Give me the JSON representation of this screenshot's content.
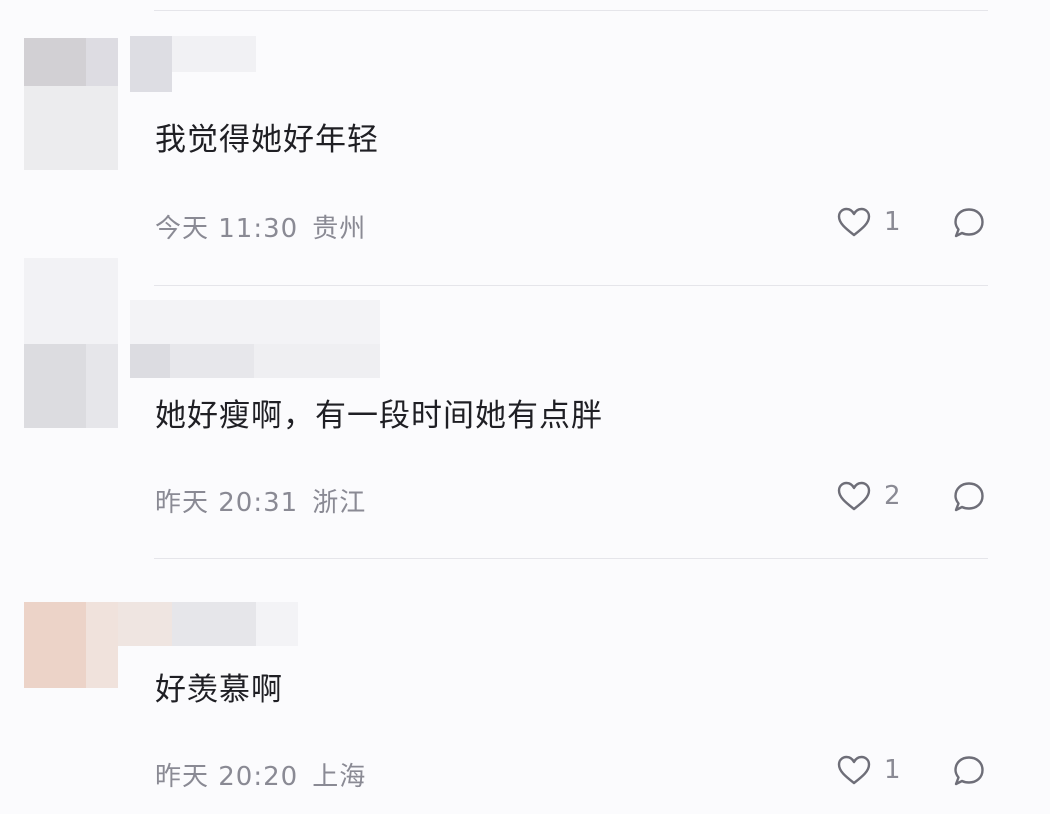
{
  "comments": [
    {
      "text": "我觉得她好年轻",
      "time": "今天 11:30",
      "location": "贵州",
      "likes": "1"
    },
    {
      "text": "她好瘦啊，有一段时间她有点胖",
      "time": "昨天 20:31",
      "location": "浙江",
      "likes": "2"
    },
    {
      "text": "好羡慕啊",
      "time": "昨天 20:20",
      "location": "上海",
      "likes": "1"
    }
  ],
  "icons": {
    "like": "heart-icon",
    "reply": "comment-bubble-icon"
  },
  "colors": {
    "background": "#fbfbfd",
    "text": "#1f1f24",
    "meta": "#8a8a94",
    "divider": "#e5e5ea"
  }
}
